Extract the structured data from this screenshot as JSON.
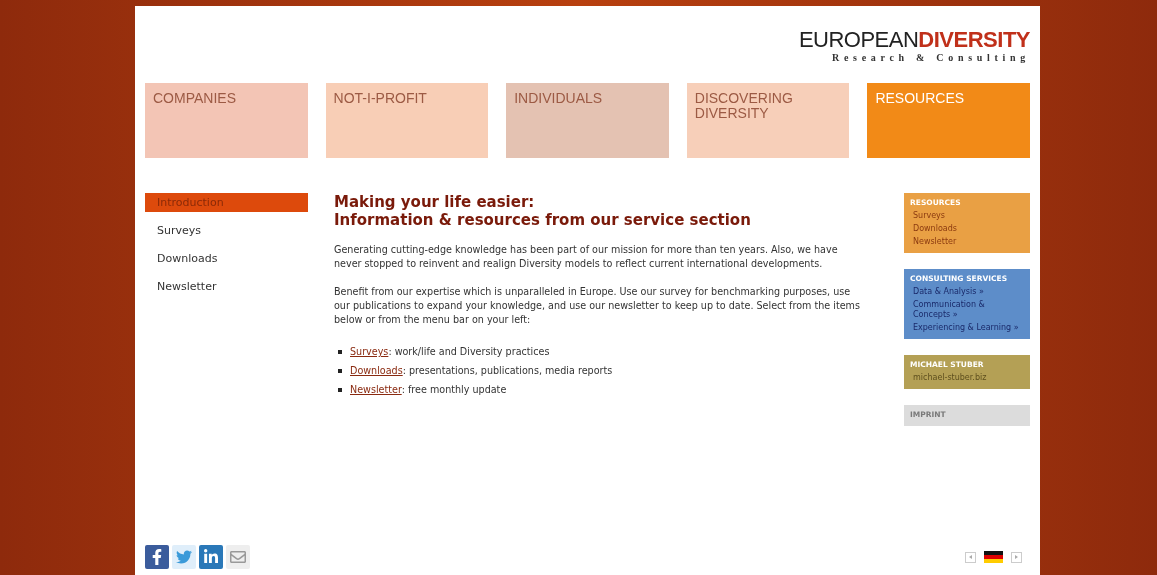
{
  "logo": {
    "light": "EUROPEAN",
    "bold": "DIVERSITY",
    "tagline": "Research & Consulting"
  },
  "tabs": [
    {
      "label": "COMPANIES",
      "selected": false,
      "color": "#f3c5b5"
    },
    {
      "label": "NOT-I-PROFIT",
      "selected": false,
      "color": "#f8ceb6"
    },
    {
      "label": "INDIVIDUALS",
      "selected": false,
      "color": "#e4c2b2"
    },
    {
      "label": "DISCOVERING DIVERSITY",
      "selected": false,
      "color": "#f7cfb9"
    },
    {
      "label": "RESOURCES",
      "selected": true,
      "color": "#f28a17"
    }
  ],
  "sidebar": {
    "items": [
      {
        "label": "Introduction",
        "selected": true
      },
      {
        "label": "Surveys",
        "selected": false
      },
      {
        "label": "Downloads",
        "selected": false
      },
      {
        "label": "Newsletter",
        "selected": false
      }
    ]
  },
  "main": {
    "title": "Making your life easier:",
    "subtitle": "Information & resources from our service section",
    "paragraphs": [
      "Generating cutting-edge knowledge has been part of our mission for more than ten years. Also, we have never stopped to reinvent and realign Diversity models to reflect current international developments.",
      "Benefit from our expertise which is unparalleled in Europe. Use our survey for benchmarking purposes, use our publications to expand your knowledge, and use our newsletter to keep up to date. Select from the items below or from the menu bar on your left:"
    ],
    "list": [
      {
        "link": "Surveys",
        "text": ": work/life and Diversity practices"
      },
      {
        "link": "Downloads",
        "text": ": presentations, publications, media reports"
      },
      {
        "link": "Newsletter",
        "text": ": free monthly update"
      }
    ]
  },
  "right_boxes": [
    {
      "title": "RESOURCES",
      "color": "#e9a044",
      "links": [
        "Surveys",
        "Downloads",
        "Newsletter"
      ]
    },
    {
      "title": "CONSULTING SERVICES",
      "color": "#5d8dc9",
      "links": [
        "Data & Analysis »",
        "Communication & Concepts »",
        "Experiencing & Learning »"
      ]
    },
    {
      "title": "MICHAEL STUBER",
      "color": "#b4a055",
      "links": [
        "michael-stuber.biz"
      ]
    },
    {
      "title": "IMPRINT",
      "color": "#dcdcdc"
    }
  ]
}
